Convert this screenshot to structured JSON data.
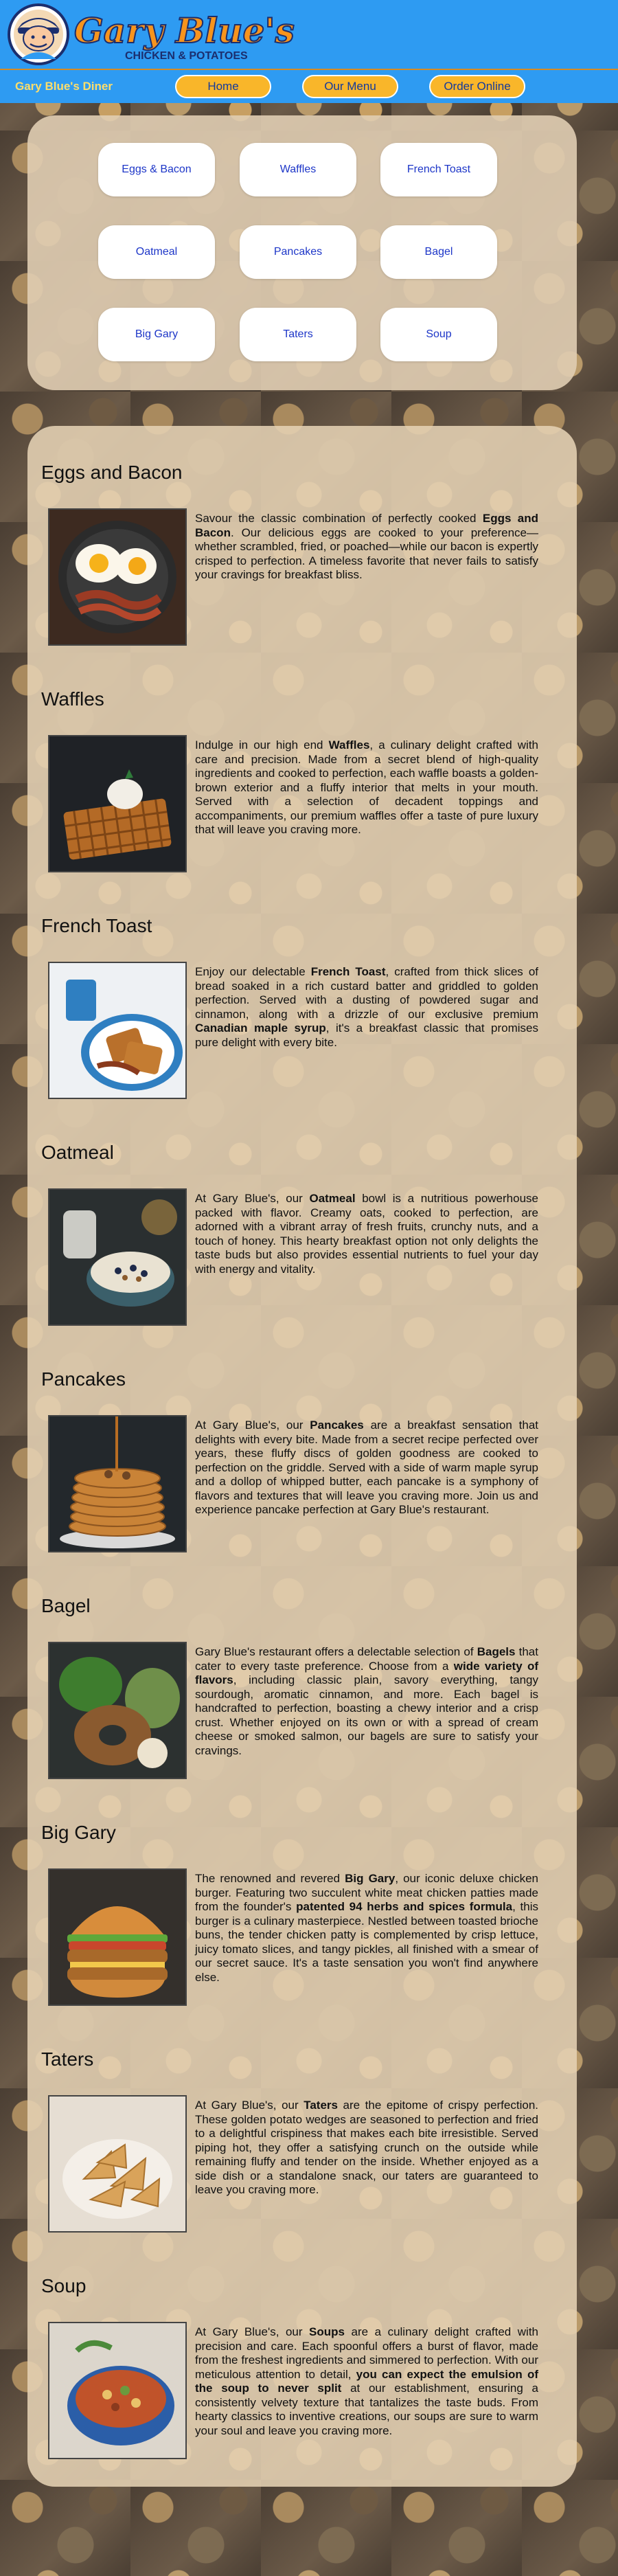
{
  "header": {
    "logo_title": "Gary Blue's",
    "logo_subtitle": "CHICKEN & POTATOES",
    "brand": "Gary Blue's Diner",
    "nav": [
      "Home",
      "Our Menu",
      "Order Online"
    ]
  },
  "menu_buttons": [
    "Eggs & Bacon",
    "Waffles",
    "French Toast",
    "Oatmeal",
    "Pancakes",
    "Bagel",
    "Big Gary",
    "Taters",
    "Soup"
  ],
  "sections": [
    {
      "title": "Eggs and Bacon",
      "image": "eggs-and-bacon-photo",
      "parts": [
        {
          "t": "Savour the classic combination of perfectly cooked "
        },
        {
          "t": "Eggs and Bacon",
          "b": true
        },
        {
          "t": ". Our delicious eggs are cooked to your preference—whether scrambled, fried, or poached—while our bacon is expertly crisped to perfection. A timeless favorite that never fails to satisfy your cravings for breakfast bliss."
        }
      ]
    },
    {
      "title": "Waffles",
      "image": "waffles-photo",
      "parts": [
        {
          "t": "Indulge in our high end "
        },
        {
          "t": "Waffles",
          "b": true
        },
        {
          "t": ", a culinary delight crafted with care and precision. Made from a secret blend of high-quality ingredients and cooked to perfection, each waffle boasts a golden-brown exterior and a fluffy interior that melts in your mouth. Served with a selection of decadent toppings and accompaniments, our premium waffles offer a taste of pure luxury that will leave you craving more."
        }
      ]
    },
    {
      "title": "French Toast",
      "image": "french-toast-photo",
      "parts": [
        {
          "t": "Enjoy our delectable "
        },
        {
          "t": "French Toast",
          "b": true
        },
        {
          "t": ", crafted from thick slices of bread soaked in a rich custard batter and griddled to golden perfection. Served with a dusting of powdered sugar and cinnamon, along with a drizzle of our exclusive premium "
        },
        {
          "t": "Canadian maple syrup",
          "b": true
        },
        {
          "t": ", it's a breakfast classic that promises pure delight with every bite."
        }
      ]
    },
    {
      "title": "Oatmeal",
      "image": "oatmeal-photo",
      "parts": [
        {
          "t": "At Gary Blue's, our "
        },
        {
          "t": "Oatmeal",
          "b": true
        },
        {
          "t": " bowl is a nutritious powerhouse packed with flavor. Creamy oats, cooked to perfection, are adorned with a vibrant array of fresh fruits, crunchy nuts, and a touch of honey. This hearty breakfast option not only delights the taste buds but also provides essential nutrients to fuel your day with energy and vitality."
        }
      ]
    },
    {
      "title": "Pancakes",
      "image": "pancakes-photo",
      "parts": [
        {
          "t": "At Gary Blue's, our "
        },
        {
          "t": "Pancakes",
          "b": true
        },
        {
          "t": " are a breakfast sensation that delights with every bite. Made from a secret recipe perfected over years, these fluffy discs of golden goodness are cooked to perfection on the griddle. Served with a side of warm maple syrup and a dollop of whipped butter, each pancake is a symphony of flavors and textures that will leave you craving more. Join us and experience pancake perfection at Gary Blue's restaurant."
        }
      ]
    },
    {
      "title": "Bagel",
      "image": "bagel-photo",
      "parts": [
        {
          "t": "Gary Blue's restaurant offers a delectable selection of "
        },
        {
          "t": "Bagels",
          "b": true
        },
        {
          "t": " that cater to every taste preference. Choose from a "
        },
        {
          "t": "wide variety of flavors",
          "b": true
        },
        {
          "t": ", including classic plain, savory everything, tangy sourdough, aromatic cinnamon, and more. Each bagel is handcrafted to perfection, boasting a chewy interior and a crisp crust. Whether enjoyed on its own or with a spread of cream cheese or smoked salmon, our bagels are sure to satisfy your cravings."
        }
      ]
    },
    {
      "title": "Big Gary",
      "image": "big-gary-burger-photo",
      "parts": [
        {
          "t": "The renowned and revered "
        },
        {
          "t": "Big Gary",
          "b": true
        },
        {
          "t": ", our iconic deluxe chicken burger. Featuring two succulent white meat chicken patties made from the founder's "
        },
        {
          "t": "patented 94 herbs and spices formula",
          "b": true
        },
        {
          "t": ", this burger is a culinary masterpiece. Nestled between toasted brioche buns, the tender chicken patty is complemented by crisp lettuce, juicy tomato slices, and tangy pickles, all finished with a smear of our secret sauce. It's a taste sensation you won't find anywhere else."
        }
      ]
    },
    {
      "title": "Taters",
      "image": "taters-photo",
      "parts": [
        {
          "t": "At Gary Blue's, our "
        },
        {
          "t": "Taters",
          "b": true
        },
        {
          "t": " are the epitome of crispy perfection. These golden potato wedges are seasoned to perfection and fried to a delightful crispiness that makes each bite irresistible. Served piping hot, they offer a satisfying crunch on the outside while remaining fluffy and tender on the inside. Whether enjoyed as a side dish or a standalone snack, our taters are guaranteed to leave you craving more."
        }
      ]
    },
    {
      "title": "Soup",
      "image": "soup-photo",
      "parts": [
        {
          "t": "At Gary Blue's, our "
        },
        {
          "t": "Soups",
          "b": true
        },
        {
          "t": " are a culinary delight crafted with precision and care. Each spoonful offers a burst of flavor, made from the freshest ingredients and simmered to perfection. With our meticulous attention to detail, "
        },
        {
          "t": "you can expect the emulsion of the soup to never split",
          "b": true
        },
        {
          "t": " at our establishment, ensuring a consistently velvety texture that tantalizes the taste buds. From hearty classics to inventive creations, our soups are sure to warm your soul and leave you craving more."
        }
      ]
    }
  ],
  "colors": {
    "header_blue": "#2e9bf2",
    "nav_button": "#f9b62a",
    "nav_text": "#143a9c",
    "brand_text": "#ffde6a",
    "menu_link": "#1d36c8",
    "logo_orange": "#f7941d"
  }
}
